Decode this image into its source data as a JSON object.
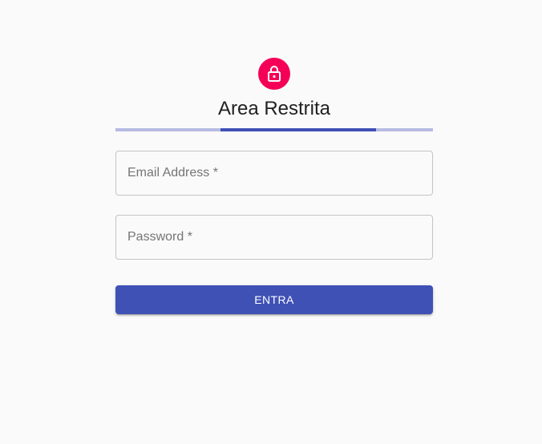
{
  "header": {
    "avatar_icon": "lock-icon",
    "avatar_color": "#f50057",
    "title": "Area Restrita"
  },
  "progress": {
    "indeterminate": true,
    "track_color": "#b6bce2",
    "bar_color": "#3f51b5"
  },
  "form": {
    "email": {
      "label": "Email Address *",
      "value": ""
    },
    "password": {
      "label": "Password *",
      "value": ""
    },
    "submit_label": "ENTRA",
    "accent_color": "#3f51b5"
  }
}
